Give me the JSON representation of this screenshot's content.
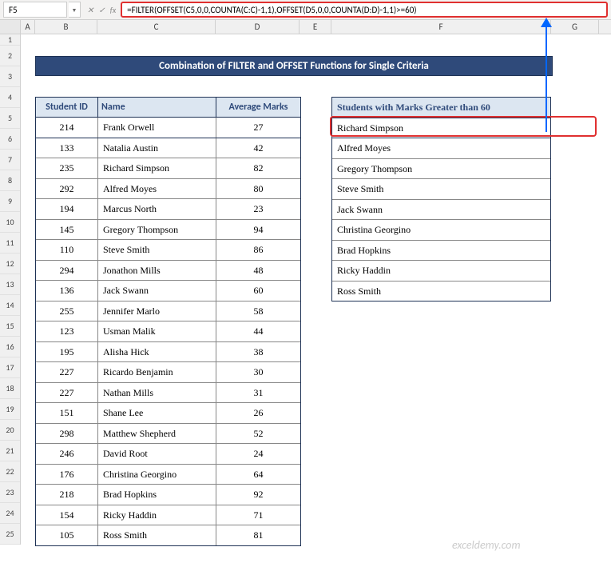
{
  "cell_ref": "F5",
  "formula": "=FILTER(OFFSET(C5,0,0,COUNTA(C:C)-1,1),OFFSET(D5,0,0,COUNTA(D:D)-1,1)>=60)",
  "fx_cancel": "✕",
  "fx_confirm": "✓",
  "fx_label": "fx",
  "columns": [
    "A",
    "B",
    "C",
    "D",
    "E",
    "F",
    "G"
  ],
  "title": "Combination of FILTER and OFFSET Functions for Single Criteria",
  "headers": {
    "id": "Student ID",
    "name": "Name",
    "marks": "Average Marks",
    "result": "Students with Marks Greater than 60"
  },
  "students": [
    {
      "id": "214",
      "name": "Frank Orwell",
      "marks": "27"
    },
    {
      "id": "133",
      "name": "Natalia Austin",
      "marks": "42"
    },
    {
      "id": "235",
      "name": "Richard Simpson",
      "marks": "82"
    },
    {
      "id": "292",
      "name": "Alfred Moyes",
      "marks": "80"
    },
    {
      "id": "194",
      "name": "Marcus North",
      "marks": "23"
    },
    {
      "id": "145",
      "name": "Gregory Thompson",
      "marks": "94"
    },
    {
      "id": "110",
      "name": "Steve Smith",
      "marks": "86"
    },
    {
      "id": "294",
      "name": "Jonathon Mills",
      "marks": "48"
    },
    {
      "id": "136",
      "name": "Jack Swann",
      "marks": "60"
    },
    {
      "id": "255",
      "name": "Jennifer Marlo",
      "marks": "58"
    },
    {
      "id": "123",
      "name": "Usman Malik",
      "marks": "44"
    },
    {
      "id": "195",
      "name": "Alisha Hick",
      "marks": "38"
    },
    {
      "id": "227",
      "name": "Ricardo Benjamin",
      "marks": "30"
    },
    {
      "id": "227",
      "name": "Nathan Mills",
      "marks": "31"
    },
    {
      "id": "151",
      "name": "Shane Lee",
      "marks": "26"
    },
    {
      "id": "298",
      "name": "Matthew Shepherd",
      "marks": "52"
    },
    {
      "id": "246",
      "name": "David Root",
      "marks": "24"
    },
    {
      "id": "176",
      "name": "Christina Georgino",
      "marks": "64"
    },
    {
      "id": "218",
      "name": "Brad Hopkins",
      "marks": "92"
    },
    {
      "id": "154",
      "name": "Ricky Haddin",
      "marks": "71"
    },
    {
      "id": "105",
      "name": "Ross Smith",
      "marks": "81"
    }
  ],
  "results": [
    "Richard Simpson",
    "Alfred Moyes",
    "Gregory Thompson",
    "Steve Smith",
    "Jack Swann",
    "Christina Georgino",
    "Brad Hopkins",
    "Ricky Haddin",
    "Ross Smith"
  ],
  "watermark": "exceldemy.com",
  "row_start": 1,
  "row_end": 25
}
